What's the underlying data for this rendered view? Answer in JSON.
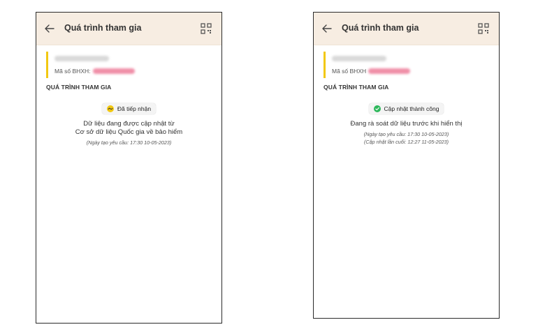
{
  "screens": [
    {
      "header": {
        "title": "Quá trình tham gia"
      },
      "info": {
        "bhxh_label": "Mã số BHXH:"
      },
      "section_title": "QUÁ TRÌNH THAM GIA",
      "status": {
        "label": "Đã tiếp nhận",
        "color": "#f2c811",
        "icon": "sync-icon"
      },
      "message_lines": [
        "Dữ liệu đang được cập nhật từ",
        "Cơ sở dữ liệu Quốc gia về bảo hiểm"
      ],
      "meta_lines": [
        "(Ngày tạo yêu cầu: 17:30 10-05-2023)"
      ]
    },
    {
      "header": {
        "title": "Quá trình tham gia"
      },
      "info": {
        "bhxh_label": "Mã số BHXH"
      },
      "section_title": "QUÁ TRÌNH THAM GIA",
      "status": {
        "label": "Cập nhật thành công",
        "color": "#2eb85c",
        "icon": "check-circle-icon"
      },
      "message_lines": [
        "Đang rà soát dữ liệu trước khi hiển thị"
      ],
      "meta_lines": [
        "(Ngày tạo yêu cầu: 17:30 10-05-2023)",
        "(Cập nhật lần cuối: 12:27 11-05-2023)"
      ]
    }
  ]
}
